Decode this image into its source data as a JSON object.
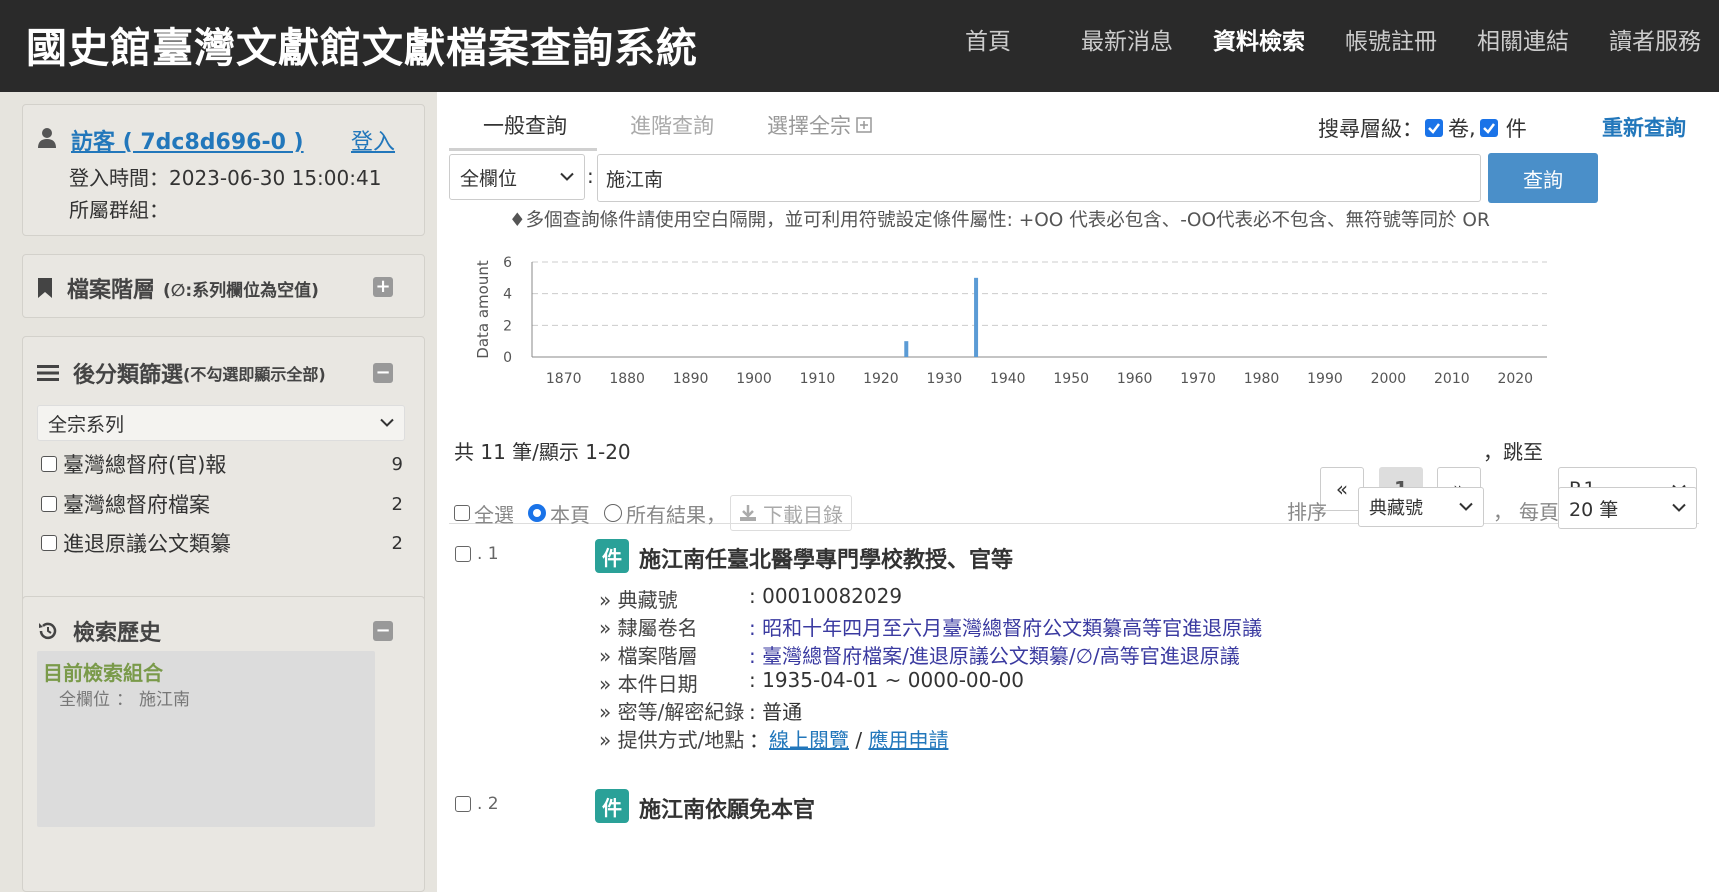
{
  "header": {
    "site_title": "國史館臺灣文獻館文獻檔案查詢系統",
    "nav": [
      "首頁",
      "最新消息",
      "資料檢索",
      "帳號註冊",
      "相關連結",
      "讀者服務"
    ]
  },
  "user": {
    "name": "訪客 ( 7dc8d696-0 )",
    "login_label": "登入",
    "login_time_label": "登入時間：",
    "login_time": "2023-06-30 15:00:41",
    "group_label": "所屬群組："
  },
  "hierarchy": {
    "title": "檔案階層",
    "note": "(∅:系列欄位為空值)"
  },
  "filter": {
    "title": "後分類篩選",
    "note": "(不勾選即顯示全部)",
    "select_value": "全宗系列",
    "items": [
      {
        "label": "臺灣總督府(官)報",
        "count": "9"
      },
      {
        "label": "臺灣總督府檔案",
        "count": "2"
      },
      {
        "label": "進退原議公文類纂",
        "count": "2"
      }
    ]
  },
  "history": {
    "title": "檢索歷史",
    "current_label": "目前檢索組合",
    "entry_field": "全欄位",
    "entry_sep": "：",
    "entry_value": "施江南"
  },
  "search": {
    "tabs": [
      "一般查詢",
      "進階查詢",
      "選擇全宗"
    ],
    "level_label": "搜尋層級：",
    "level_opt1": "卷",
    "level_sep": ",",
    "level_opt2": "件",
    "reset_label": "重新查詢",
    "field_select": "全欄位",
    "colon": ":",
    "query": "施江南",
    "button": "查詢",
    "hint": "♦多個查詢條件請使用空白隔開，並可利用符號設定條件屬性: +OO 代表必包含、-OO代表必不包含、無符號等同於 OR"
  },
  "chart_data": {
    "type": "bar",
    "ylabel": "Data amount",
    "xlabel": "",
    "xlim": [
      1865,
      2025
    ],
    "ylim": [
      0,
      6
    ],
    "yticks": [
      "0",
      "2",
      "4",
      "6"
    ],
    "xticks": [
      "1870",
      "1880",
      "1890",
      "1900",
      "1910",
      "1920",
      "1930",
      "1940",
      "1950",
      "1960",
      "1970",
      "1980",
      "1990",
      "2000",
      "2010",
      "2020"
    ],
    "x": [
      1924,
      1935
    ],
    "values": [
      1,
      5
    ],
    "grid": true,
    "color": "#5b9bd5"
  },
  "results": {
    "summary": "共 11 筆/顯示 1-20",
    "prev": "«",
    "page": "1",
    "next": "»",
    "jump_label": "，跳至",
    "jump_value": "P.1",
    "select_all": "全選",
    "this_page": "本頁",
    "all_results": "所有結果，",
    "download": "下載目錄",
    "sort_label": "排序",
    "sort_value": "典藏號",
    "per_page_sep": "，",
    "per_page_label": "每頁",
    "per_page_value": "20 筆",
    "badge": "件",
    "records": [
      {
        "num": ". 1",
        "title": "施江南任臺北醫學專門學校教授、官等",
        "fields": [
          {
            "label": "» 典藏號",
            "value": ": 00010082029"
          },
          {
            "label": "» 隸屬卷名",
            "value": ": 昭和十年四月至六月臺灣總督府公文類纂高等官進退原議"
          },
          {
            "label": "» 檔案階層",
            "value": ": 臺灣總督府檔案/進退原議公文類纂/∅/高等官進退原議"
          },
          {
            "label": "» 本件日期",
            "value": ": 1935-04-01 ~ 0000-00-00"
          },
          {
            "label": "» 密等/解密紀錄",
            "value": ": 普通"
          },
          {
            "label": "» 提供方式/地點",
            "value": "："
          }
        ],
        "link1": "線上閱覽",
        "link_sep": " / ",
        "link2": "應用申請"
      },
      {
        "num": ". 2",
        "title": "施江南依願免本官"
      }
    ]
  }
}
